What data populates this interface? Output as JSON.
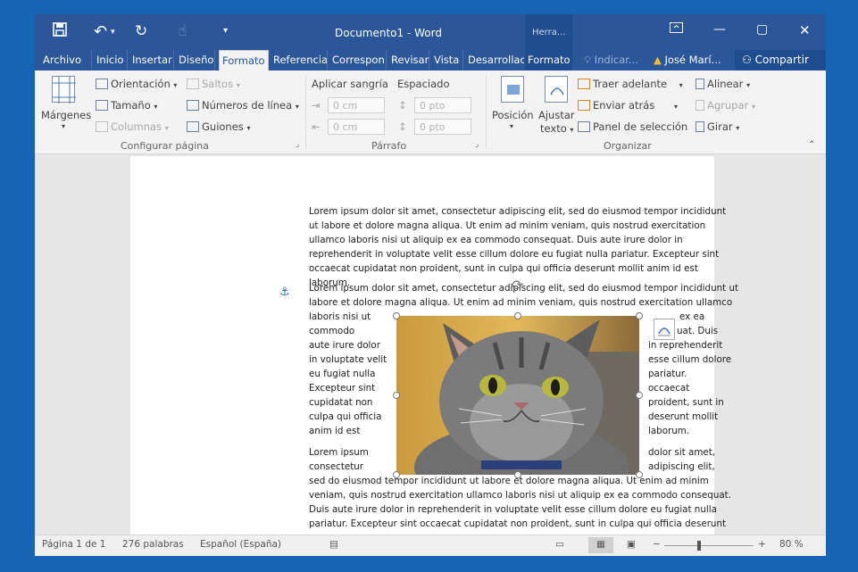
{
  "titlebar": {
    "title": "Documento1 - Word",
    "context_group": "Herra..."
  },
  "tabs": [
    {
      "label": "Archivo"
    },
    {
      "label": "Inicio"
    },
    {
      "label": "Insertar"
    },
    {
      "label": "Diseño"
    },
    {
      "label": "Formato"
    },
    {
      "label": "Referencia"
    },
    {
      "label": "Correspon"
    },
    {
      "label": "Revisar"
    },
    {
      "label": "Vista"
    },
    {
      "label": "Desarrollac"
    },
    {
      "label": "Formato"
    }
  ],
  "tell_me": "Indicar...",
  "user": "José Marí...",
  "share": "Compartir",
  "ribbon": {
    "margenes": "Márgenes",
    "orientacion": "Orientación",
    "tamano": "Tamaño",
    "columnas": "Columnas",
    "saltos": "Saltos",
    "numeros_linea": "Números de línea",
    "guiones": "Guiones",
    "group_configurar": "Configurar página",
    "aplicar_sangria": "Aplicar sangría",
    "espaciado": "Espaciado",
    "indent_left": "0 cm",
    "indent_right": "0 cm",
    "space_before": "0 pto",
    "space_after": "0 pto",
    "group_parrafo": "Párrafo",
    "posicion": "Posición",
    "ajustar": "Ajustar",
    "texto": "texto",
    "traer_adelante": "Traer adelante",
    "enviar_atras": "Enviar atrás",
    "panel_seleccion": "Panel de selección",
    "alinear": "Alinear",
    "agrupar": "Agrupar",
    "girar": "Girar",
    "group_organizar": "Organizar"
  },
  "document": {
    "para1": "Lorem ipsum dolor sit amet, consectetur adipiscing elit, sed do eiusmod tempor incididunt ut labore et dolore magna aliqua. Ut enim ad minim veniam, quis nostrud exercitation ullamco laboris nisi ut aliquip ex ea commodo consequat. Duis aute irure dolor in reprehenderit in voluptate velit esse cillum dolore eu fugiat nulla pariatur. Excepteur sint occaecat cupidatat non proident, sunt in culpa qui officia deserunt mollit anim id est laborum.",
    "p2_top": [
      "Lorem ipsum dolor sit amet, consectetur adipiscing elit, sed do eiusmod tempor incididunt ut",
      "labore et dolore magna aliqua. Ut enim ad minim veniam, quis nostrud exercitation ullamco"
    ],
    "p2_left": [
      "laboris nisi ut",
      "commodo",
      "aute irure dolor",
      "in voluptate velit",
      "eu fugiat nulla",
      "Excepteur sint",
      "cupidatat non",
      "culpa qui officia",
      "anim id est"
    ],
    "p2_right": [
      "ex ea",
      "uat. Duis",
      "in reprehenderit",
      "esse cillum dolore",
      "pariatur.",
      "occaecat",
      "proident, sunt in",
      "deserunt mollit",
      "laborum."
    ],
    "p3_left": [
      "Lorem ipsum",
      "consectetur"
    ],
    "p3_right": [
      "dolor sit amet,",
      "adipiscing elit,"
    ],
    "p3_bottom": [
      "sed do eiusmod tempor incididunt ut labore et dolore magna aliqua. Ut enim ad minim",
      "veniam, quis nostrud exercitation ullamco laboris nisi ut aliquip ex ea commodo consequat.",
      "Duis aute irure dolor in reprehenderit in voluptate velit esse cillum dolore eu fugiat nulla",
      "pariatur. Excepteur sint occaecat cupidatat non proident, sunt in culpa qui officia deserunt"
    ]
  },
  "status": {
    "page": "Página 1 de 1",
    "words": "276 palabras",
    "language": "Español (España)",
    "zoom": "80 %",
    "zoom_value": 80
  },
  "colors": {
    "word_blue": "#2b579a",
    "background": "#1565b4"
  }
}
